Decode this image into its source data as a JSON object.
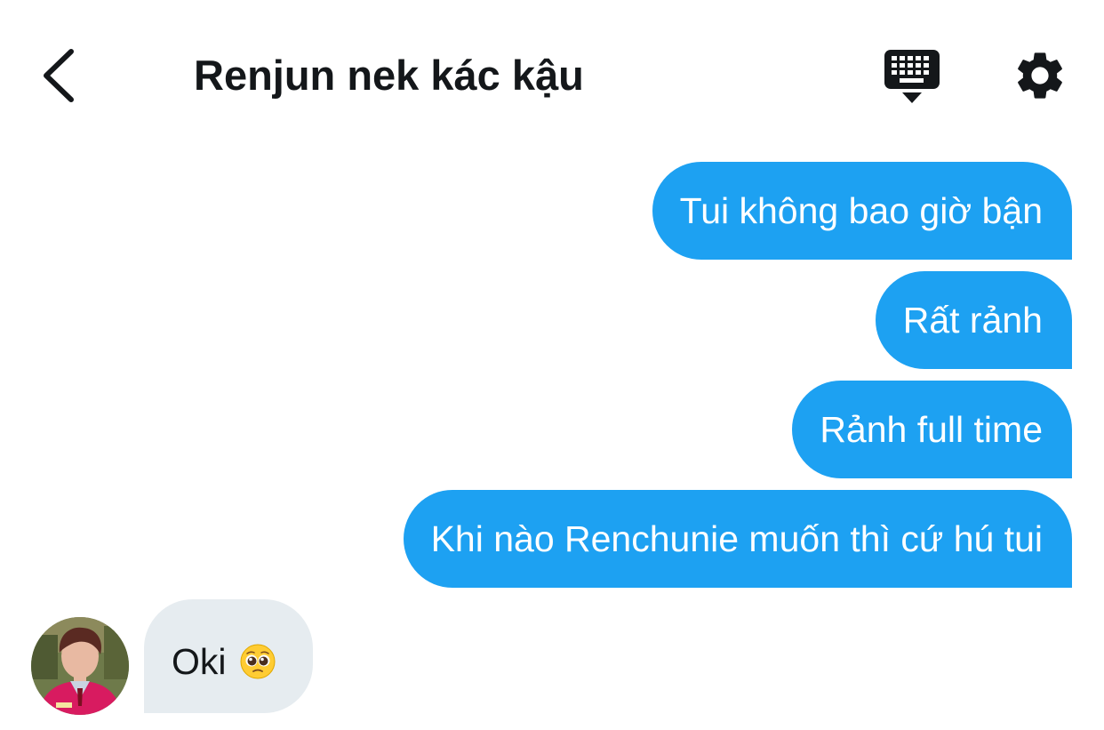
{
  "header": {
    "title": "Renjun nek kác kậu",
    "back_icon": "chevron-left-icon",
    "keyboard_icon": "keyboard-icon",
    "settings_icon": "gear-icon"
  },
  "messages": [
    {
      "direction": "outgoing",
      "text": "Tui không bao giờ bận"
    },
    {
      "direction": "outgoing",
      "text": "Rất rảnh"
    },
    {
      "direction": "outgoing",
      "text": "Rảnh full time"
    },
    {
      "direction": "outgoing",
      "text": "Khi nào Renchunie muốn thì cứ hú tui"
    },
    {
      "direction": "incoming",
      "text": "Oki",
      "emoji": "pleading-face-emoji"
    }
  ],
  "colors": {
    "outgoing_bubble": "#1da1f2",
    "incoming_bubble": "#e6ecf0",
    "text_dark": "#14171a"
  }
}
